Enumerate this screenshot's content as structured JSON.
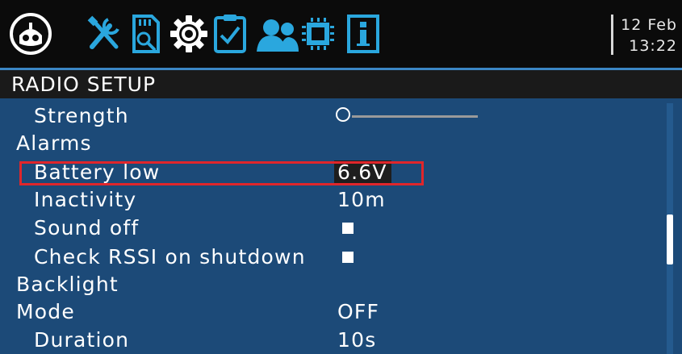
{
  "toolbar": {
    "icons": [
      "radio-model-icon",
      "tools-icon",
      "sd-card-icon",
      "gear-icon",
      "checklist-icon",
      "users-icon",
      "hardware-icon",
      "info-icon"
    ]
  },
  "datetime": {
    "date": "12 Feb",
    "time": "13:22"
  },
  "title": "RADIO SETUP",
  "rows": [
    {
      "label": "Strength"
    },
    {
      "label": "Alarms"
    },
    {
      "label": "Battery low",
      "value": "6.6V"
    },
    {
      "label": "Inactivity",
      "value": "10m"
    },
    {
      "label": "Sound off",
      "checked": false
    },
    {
      "label": "Check RSSI on shutdown",
      "checked": false
    },
    {
      "label": "Backlight"
    },
    {
      "label": "Mode",
      "value": "OFF"
    },
    {
      "label": "Duration",
      "value": "10s"
    }
  ],
  "strength_level": 0.0,
  "colors": {
    "background": "#1c4a78",
    "topbar": "#0b0b0b",
    "titlebar": "#1a1a1a",
    "accent": "#3b86c4",
    "highlight": "#e0262b",
    "icon": "#2aa7de"
  }
}
